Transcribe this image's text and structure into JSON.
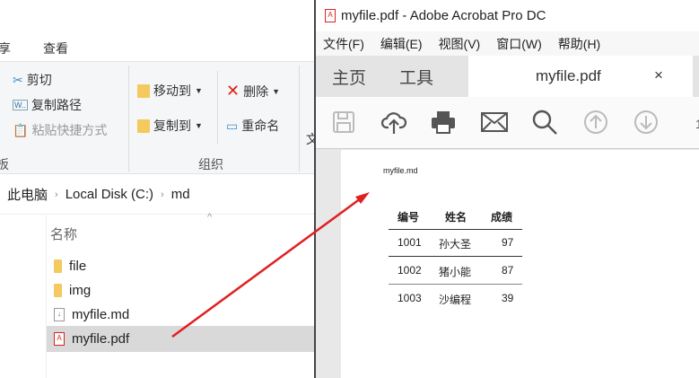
{
  "explorer": {
    "ribbon_tabs": [
      "享",
      "查看"
    ],
    "clipboard": {
      "cut": "剪切",
      "copy_path": "复制路径",
      "paste_shortcut": "粘贴快捷方式",
      "group": "板"
    },
    "organize": {
      "move_to": "移动到",
      "copy_to": "复制到",
      "delete": "删除",
      "rename": "重命名",
      "group": "组织"
    },
    "new_partial": "文",
    "breadcrumb": [
      "此电脑",
      "Local Disk (C:)",
      "md"
    ],
    "column_header": "名称",
    "files": [
      {
        "name": "file",
        "type": "folder"
      },
      {
        "name": "img",
        "type": "folder"
      },
      {
        "name": "myfile.md",
        "type": "md"
      },
      {
        "name": "myfile.pdf",
        "type": "pdf",
        "selected": true
      }
    ]
  },
  "acrobat": {
    "title": "myfile.pdf - Adobe Acrobat Pro DC",
    "menu": [
      "文件(F)",
      "编辑(E)",
      "视图(V)",
      "窗口(W)",
      "帮助(H)"
    ],
    "tabs": {
      "home": "主页",
      "tools": "工具",
      "document": "myfile.pdf",
      "close": "×"
    },
    "toolbar": [
      "save-icon",
      "cloud-upload-icon",
      "print-icon",
      "mail-icon",
      "search-icon",
      "page-up-icon",
      "page-down-icon"
    ],
    "page_number_partial": "1",
    "pdf": {
      "heading": "myfile.md",
      "table": {
        "headers": [
          "编号",
          "姓名",
          "成绩"
        ],
        "rows": [
          [
            "1001",
            "孙大圣",
            "97"
          ],
          [
            "1002",
            "猪小能",
            "87"
          ],
          [
            "1003",
            "沙编程",
            "39"
          ]
        ]
      }
    }
  },
  "colors": {
    "arrow": "#e02020",
    "selection": "#d9d9d9"
  }
}
